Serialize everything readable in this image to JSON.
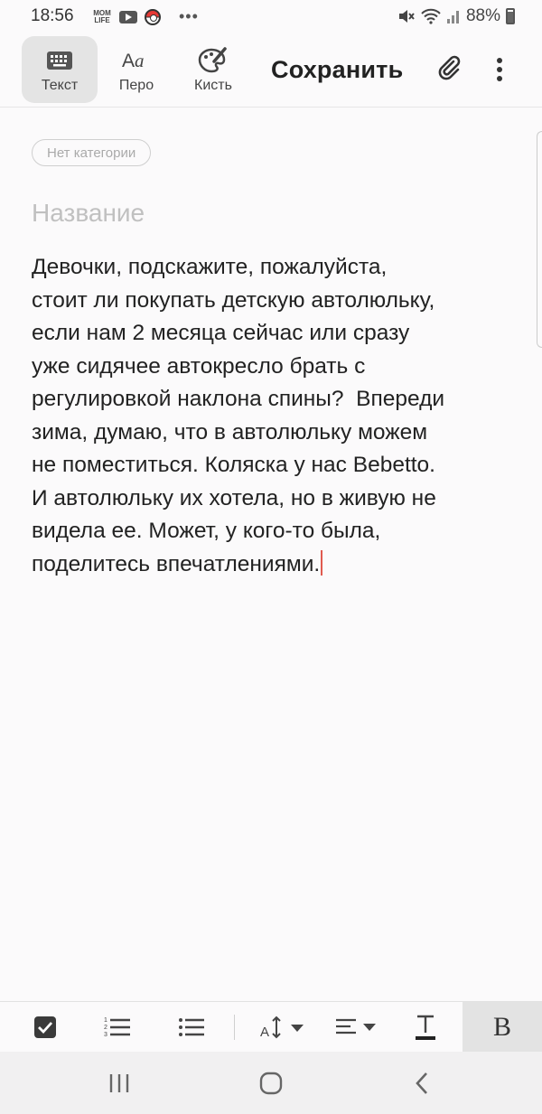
{
  "status": {
    "time": "18:56",
    "app_badge": "MOM\nLIFE",
    "more": "•••",
    "battery": "88%"
  },
  "toolbar": {
    "modes": [
      {
        "label": "Текст",
        "icon": "keyboard-icon"
      },
      {
        "label": "Перо",
        "icon": "pen-aa-icon"
      },
      {
        "label": "Кисть",
        "icon": "brush-palette-icon"
      }
    ],
    "save_label": "Сохранить",
    "attach_icon": "paperclip-icon",
    "more_icon": "more-vertical-icon"
  },
  "note": {
    "category": "Нет категории",
    "title_placeholder": "Название",
    "body": "Девочки, подскажите, пожалуйста,\nстоит ли покупать детскую автолюльку,\nесли нам 2 месяца сейчас или сразу\nуже сидячее автокресло брать с\nрегулировкой наклона спины?  Впереди\nзима, думаю, что в автолюльку можем\nне поместиться. Коляска у нас Bebetto.\nИ автолюльку их хотела, но в живую не\nвидела ее. Может, у кого-то была,\nподелитесь впечатлениями."
  },
  "format_bar": {
    "items": [
      "checkbox-icon",
      "numbered-list-icon",
      "bullet-list-icon",
      "font-size-icon",
      "align-icon",
      "text-color-icon",
      "bold-icon"
    ],
    "bold_label": "B"
  },
  "colors": {
    "caret": "#e05a4f",
    "active_mode_bg": "#e4e4e4",
    "background": "#fbfafb"
  }
}
